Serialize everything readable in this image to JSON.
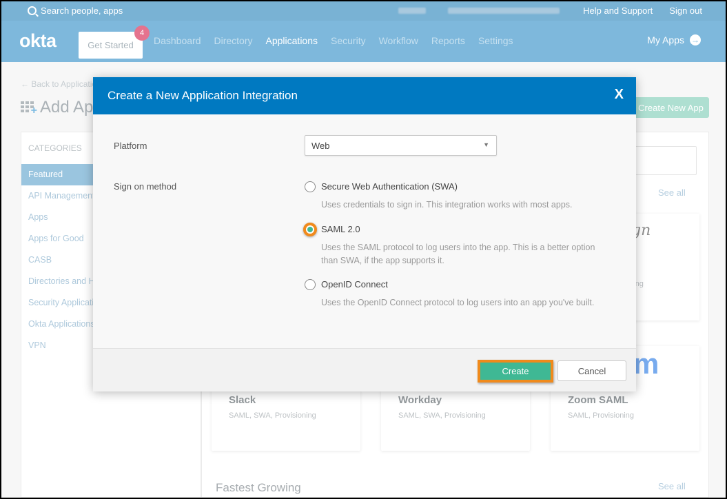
{
  "header": {
    "search_placeholder": "Search people, apps",
    "help_label": "Help and Support",
    "signout_label": "Sign out",
    "logo_text": "okta",
    "get_started_label": "Get Started",
    "get_started_badge": "4",
    "nav": [
      "Dashboard",
      "Directory",
      "Applications",
      "Security",
      "Workflow",
      "Reports",
      "Settings"
    ],
    "active_nav": "Applications",
    "my_apps_label": "My Apps"
  },
  "page": {
    "back_link": "← Back to Applications",
    "title": "Add Applications",
    "create_new_app_label": "Create New App",
    "categories_heading": "CATEGORIES",
    "categories": [
      "Featured",
      "API Management",
      "Apps",
      "Apps for Good",
      "CASB",
      "Directories and HR Systems",
      "Security Applications",
      "Okta Applications",
      "VPN"
    ],
    "selected_category": "Featured",
    "see_all_label": "See all",
    "featured_cards": [
      {
        "name": "Slack",
        "tags": "SAML, SWA, Provisioning"
      },
      {
        "name": "Workday",
        "tags": "SAML, SWA, Provisioning"
      },
      {
        "name": "Zoom SAML",
        "tags": "SAML, Provisioning"
      }
    ],
    "partial_card_logo": "ign",
    "partial_card_tags": "oning",
    "zoom_logo_fragment": "m",
    "fastest_growing_heading": "Fastest Growing"
  },
  "modal": {
    "title": "Create a New Application Integration",
    "close_label": "X",
    "platform_label": "Platform",
    "platform_value": "Web",
    "sign_on_label": "Sign on method",
    "options": [
      {
        "title": "Secure Web Authentication (SWA)",
        "desc": "Uses credentials to sign in. This integration works with most apps.",
        "checked": false
      },
      {
        "title": "SAML 2.0",
        "desc": "Uses the SAML protocol to log users into the app. This is a better option than SWA, if the app supports it.",
        "checked": true
      },
      {
        "title": "OpenID Connect",
        "desc": "Uses the OpenID Connect protocol to log users into an app you've built.",
        "checked": false
      }
    ],
    "create_label": "Create",
    "cancel_label": "Cancel"
  },
  "colors": {
    "header_blue": "#7eb8dc",
    "modal_header_blue": "#0079c1",
    "create_green": "#3fb894",
    "highlight_orange": "#f08a1c"
  }
}
